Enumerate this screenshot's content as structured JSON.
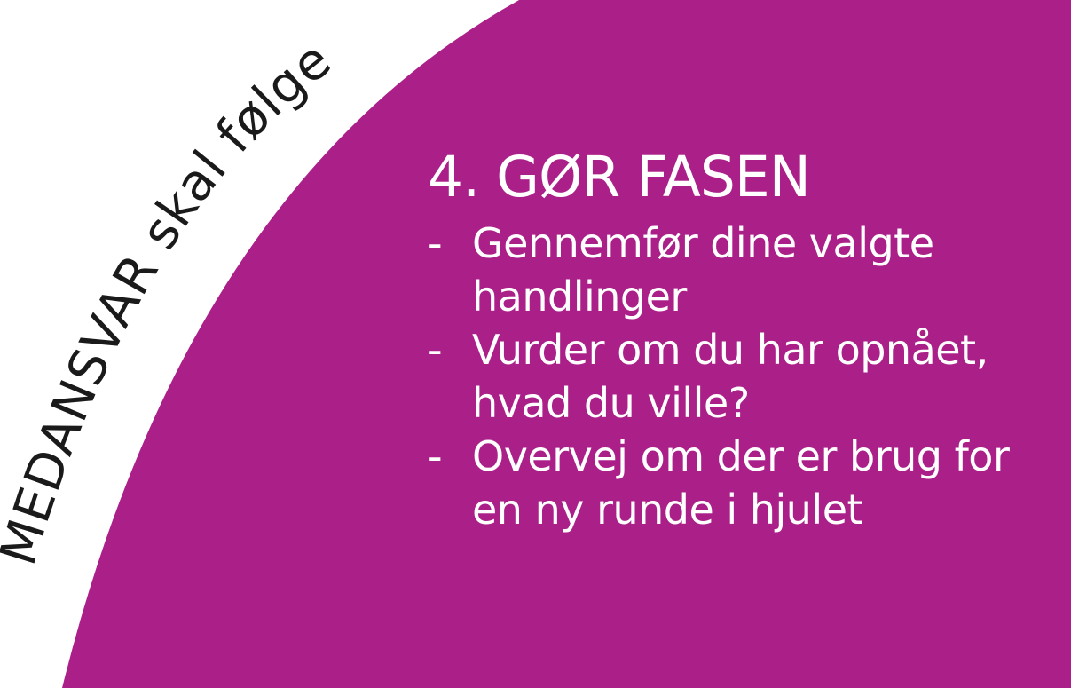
{
  "wheel": {
    "segment_color": "#ab1f89",
    "arc_label": "MEDANSVAR skal følge"
  },
  "phase": {
    "title": "4. GØR FASEN",
    "bullet_symbol": "-",
    "items": [
      {
        "text": "Gennemfør dine valgte handlinger"
      },
      {
        "text": "Vurder om du har opnået, hvad du ville?"
      },
      {
        "text": "Overvej om der er brug for en ny runde i hjulet"
      }
    ]
  }
}
